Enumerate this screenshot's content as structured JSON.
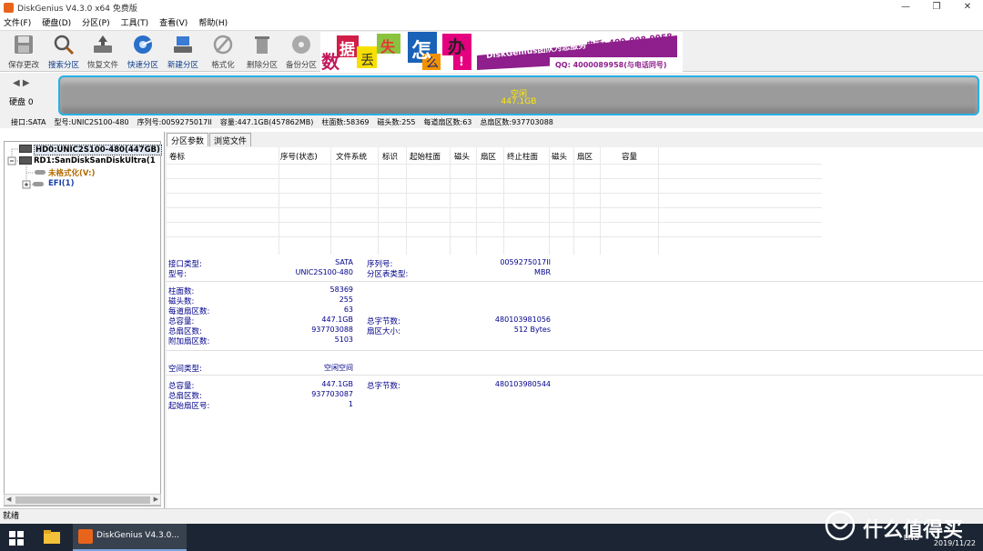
{
  "window": {
    "title": "DiskGenius V4.3.0 x64 免费版",
    "min": "—",
    "max": "❐",
    "close": "✕"
  },
  "menu": [
    "文件(F)",
    "硬盘(D)",
    "分区(P)",
    "工具(T)",
    "查看(V)",
    "帮助(H)"
  ],
  "toolbar": {
    "save": "保存更改",
    "search": "搜索分区",
    "recover": "恢复文件",
    "quick": "快速分区",
    "new": "新建分区",
    "format": "格式化",
    "delete": "删除分区",
    "backup": "备份分区"
  },
  "banner": {
    "c1": "数",
    "c2": "据",
    "c3": "丢",
    "c4": "失",
    "c5": "怎",
    "c6": "么",
    "c7": "办",
    "c8": "!",
    "team": "DiskGenius团队为您服务",
    "phone": "电话: 400-008-9958",
    "qq": "QQ: 4000089958(与电话同号)"
  },
  "disk": {
    "label": "硬盘 0",
    "state": "空闲",
    "size": "447.1GB"
  },
  "infobar": [
    "接口:SATA",
    "型号:UNIC2S100-480",
    "序列号:0059275017II",
    "容量:447.1GB(457862MB)",
    "柱面数:58369",
    "磁头数:255",
    "每道扇区数:63",
    "总扇区数:937703088"
  ],
  "tree": {
    "hd0": "HD0:UNIC2S100-480(447GB)",
    "rd1": "RD1:SanDiskSanDiskUltra(1",
    "unformatted": "未格式化(V:)",
    "efi": "EFI(1)"
  },
  "tabs": [
    "分区参数",
    "浏览文件"
  ],
  "table_headers": [
    "卷标",
    "序号(状态)",
    "文件系统",
    "标识",
    "起始柱面",
    "磁头",
    "扇区",
    "终止柱面",
    "磁头",
    "扇区",
    "容量"
  ],
  "details": {
    "iface_label": "接口类型:",
    "iface_val": "SATA",
    "serial_label": "序列号:",
    "serial_val": "0059275017II",
    "model_label": "型号:",
    "model_val": "UNIC2S100-480",
    "pt_label": "分区表类型:",
    "pt_val": "MBR",
    "cyl_label": "柱面数:",
    "cyl_val": "58369",
    "heads_label": "磁头数:",
    "heads_val": "255",
    "spt_label": "每道扇区数:",
    "spt_val": "63",
    "cap_label": "总容量:",
    "cap_val": "447.1GB",
    "bytes_label": "总字节数:",
    "bytes_val": "480103981056",
    "sec_label": "总扇区数:",
    "sec_val": "937703088",
    "secsize_label": "扇区大小:",
    "secsize_val": "512 Bytes",
    "extra_label": "附加扇区数:",
    "extra_val": "5103",
    "space_label": "空间类型:",
    "space_val": "空闲空间",
    "cap2_label": "总容量:",
    "cap2_val": "447.1GB",
    "bytes2_label": "总字节数:",
    "bytes2_val": "480103980544",
    "sec2_label": "总扇区数:",
    "sec2_val": "937703087",
    "start_label": "起始扇区号:",
    "start_val": "1"
  },
  "status": "就绪",
  "taskbar": {
    "app": "DiskGenius V4.3.0...",
    "ime": "ENG",
    "date": "2019/11/22"
  },
  "watermark": "什么值得买"
}
